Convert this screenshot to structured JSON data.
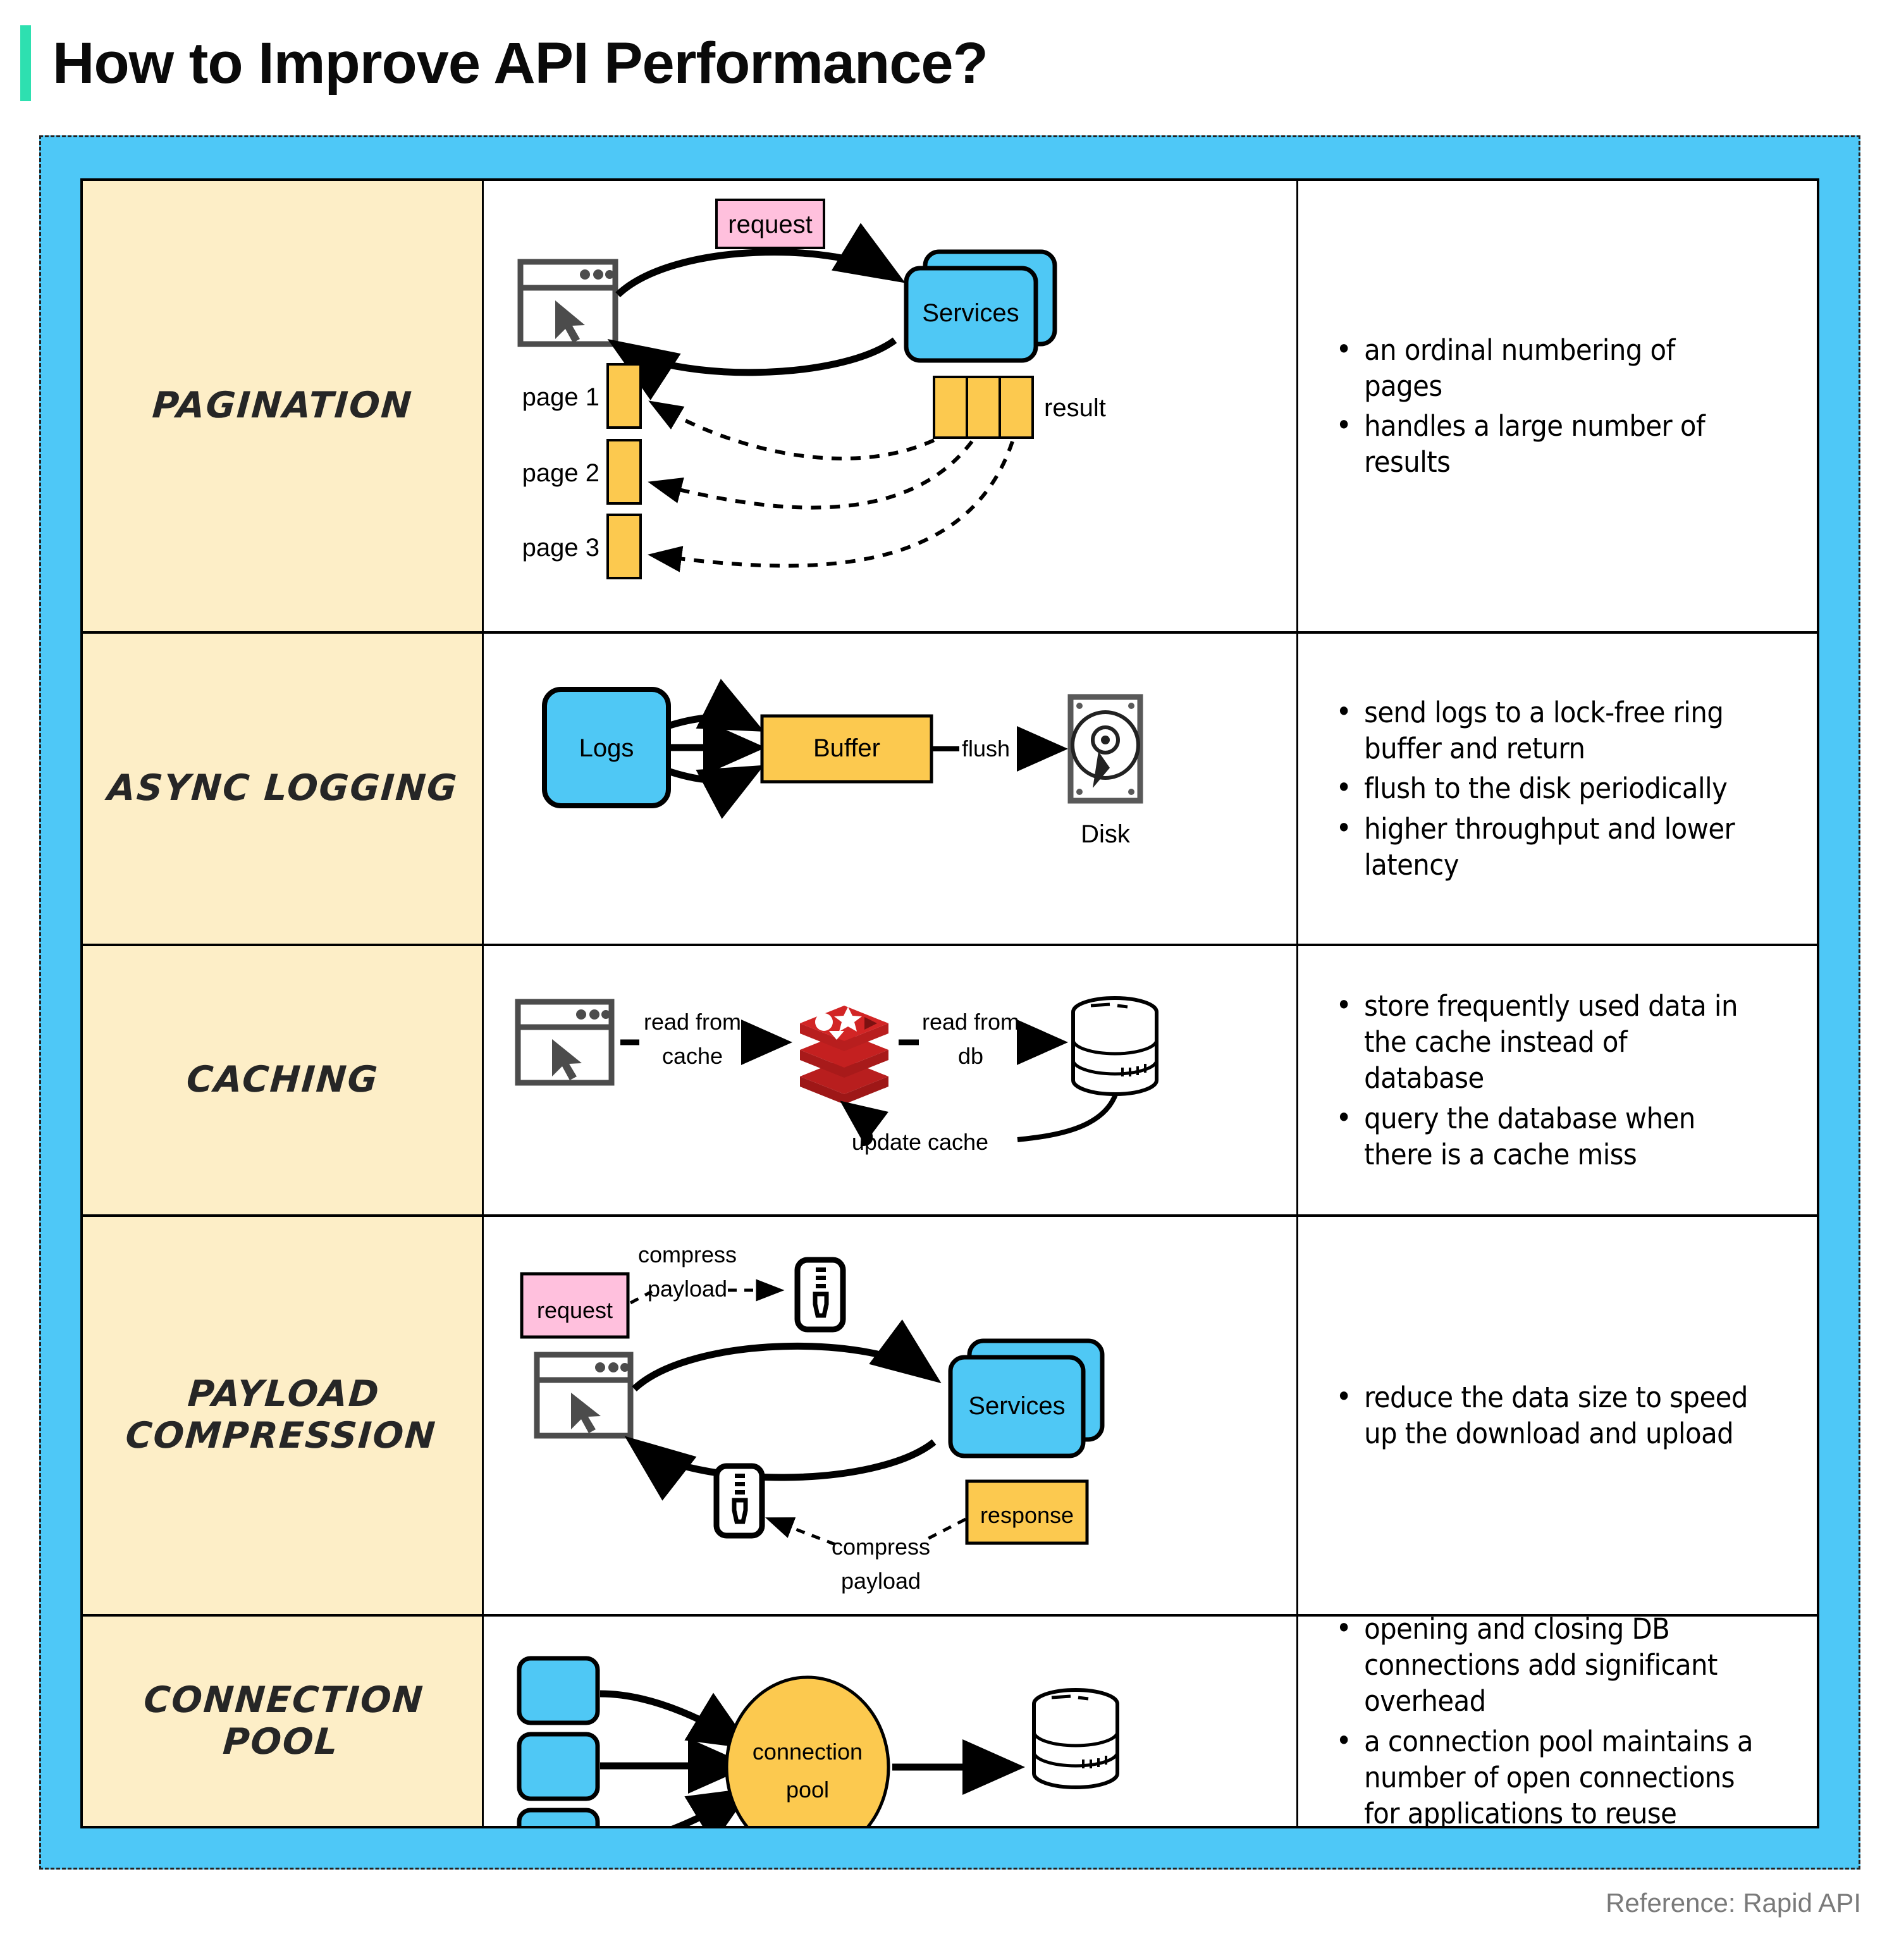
{
  "title": "How to Improve API Performance?",
  "accent_color": "#2ee0b0",
  "frame_color": "#4ec8f7",
  "label_bg_color": "#fdeec7",
  "footer": "Reference: Rapid API",
  "rows": [
    {
      "label": "Pagination",
      "diagram": {
        "request_label": "request",
        "services_label": "Services",
        "result_label": "result",
        "pages": [
          "page 1",
          "page 2",
          "page 3"
        ]
      },
      "bullets": [
        "an ordinal numbering of pages",
        "handles a large number of results"
      ]
    },
    {
      "label": "Async Logging",
      "diagram": {
        "logs_label": "Logs",
        "buffer_label": "Buffer",
        "flush_label": "flush",
        "disk_label": "Disk"
      },
      "bullets": [
        "send logs to a lock-free ring buffer and return",
        "flush to the disk periodically",
        "higher throughput and lower latency"
      ]
    },
    {
      "label": "Caching",
      "diagram": {
        "read_from_cache_label": "read from cache",
        "read_from_db_label": "read from db",
        "update_cache_label": "update cache"
      },
      "bullets": [
        "store frequently used data in the cache instead of database",
        "query the database when there is a cache miss"
      ]
    },
    {
      "label": "Payload Compression",
      "diagram": {
        "request_label": "request",
        "response_label": "response",
        "services_label": "Services",
        "compress_top_label": "compress payload",
        "compress_bottom_label": "compress payload"
      },
      "bullets": [
        "reduce the data size to speed up the download and upload"
      ]
    },
    {
      "label": "Connection Pool",
      "diagram": {
        "pool_label": "connection pool"
      },
      "bullets": [
        "opening and closing DB connections add significant overhead",
        "a connection pool maintains a number of open connections for applications to reuse"
      ]
    }
  ]
}
